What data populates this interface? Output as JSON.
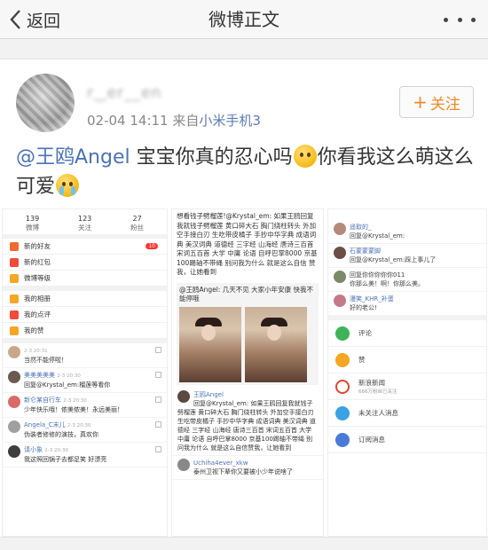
{
  "nav": {
    "back_label": "返回",
    "title": "微博正文"
  },
  "post": {
    "username": "r‿er__en",
    "time": "02-04 14:11",
    "source_prefix": "来自",
    "source": "小米手机3",
    "follow_label": "关注",
    "mention": "@王鸥Angel",
    "text_part1": " 宝宝你真的忍心吗",
    "text_part2": "你看我这么萌这么可爱",
    "emojis": [
      "thinking-face-emoji",
      "crying-face-emoji"
    ]
  },
  "screenshot1": {
    "stats": [
      {
        "value": "139",
        "label": "微博"
      },
      {
        "value": "123",
        "label": "关注"
      },
      {
        "value": "27",
        "label": "粉丝"
      }
    ],
    "menu": [
      {
        "label": "新的好友",
        "badge": "10"
      },
      {
        "label": "新的红包",
        "badge": ""
      },
      {
        "label": "微博等级",
        "badge": ""
      },
      {
        "label": "我的相册",
        "badge": ""
      },
      {
        "label": "我的点评",
        "badge": ""
      },
      {
        "label": "我的赞",
        "badge": ""
      }
    ],
    "comments": [
      {
        "name": "",
        "text": "当然不能停啦！",
        "time": "2-3 20:31"
      },
      {
        "name": "美美美美美",
        "text": "回复@Krystal_em:榴莲等看你",
        "time": "2-3 20:30"
      },
      {
        "name": "新仑某自行车",
        "text": "少年快乐哦！侬美侬美！永远美丽！",
        "time": "2-3 20:30"
      },
      {
        "name": "Angela_C末儿",
        "text": "伪装者修修的演技，真欢你",
        "time": "2-3 20:30"
      },
      {
        "name": "请小象",
        "text": "我这照回锅子去都足笑 好漂亮",
        "time": "2-3 20:30"
      }
    ]
  },
  "screenshot2": {
    "para": "想看钱子劈榴莲!@Krystal_em: 如果王鸥回复我就钱子劈榴莲 黄口碎大石 胸门绕柱转头 外加空手接白刃 生吃带皮橘子 手抄中华字典 成语词典 美汉词典 道德经 三字经 山海经 唐诗三百首 宋词五百首 大学 中庸 论语 自呼巴掌8000 京基100踢轴不带绳 别问我为什么 就是这么自信 赞我，让她看到",
    "quote": "@王鸥Angel: 几天不见 大家小年安康 快我不能停哦",
    "second_name": "王鸥Angel",
    "second_para": "回复@Krystal_em: 如果王鸥回复我就钱子劈榴莲 黄口碎大石 胸门绕柱转头 外加空手接白刃 生吃带皮橘子 手抄中华字典 成语词典 美汉词典 道德经 三字经 山海经 唐诗三百首 宋词五百首 大学 中庸 论语 自呼巴掌8000 京基100踢轴不带绳 别问我为什么 就是这么自信赞我，让她看到",
    "third_name": "Uchiha4ever_xkw",
    "third_text": "泰州卫视下辈你又要被小少年说啥了"
  },
  "screenshot3": {
    "comments": [
      {
        "name": "遥取的_",
        "text": "回复@Krystal_em:"
      },
      {
        "name": "石蒙蒙蒙脚",
        "text": "回复@Krystal_em:踩上事儿了"
      },
      {
        "name": "",
        "text": "回复你你你你你011"
      },
      {
        "name": "",
        "text": "你那么美！啊！你那么美。"
      },
      {
        "name": "漫笑_KHR_补蛋",
        "text": "好的老公!"
      }
    ],
    "rows": [
      {
        "label": "评论",
        "sub": ""
      },
      {
        "label": "赞",
        "sub": ""
      },
      {
        "label": "新浪新闻",
        "sub": "666万粉丝已关注"
      },
      {
        "label": "未关注人消息",
        "sub": ""
      },
      {
        "label": "订阅消息",
        "sub": ""
      }
    ]
  },
  "colors": {
    "link": "#4b72b8",
    "follow": "#f08a24"
  }
}
